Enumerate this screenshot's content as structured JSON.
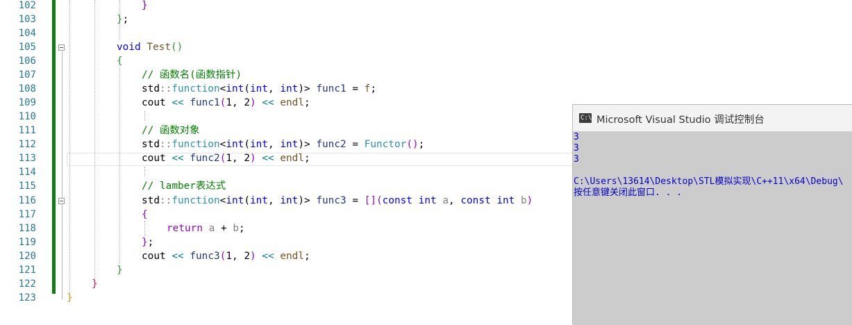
{
  "editor": {
    "lines": [
      {
        "num": "102"
      },
      {
        "num": "103"
      },
      {
        "num": "104"
      },
      {
        "num": "105"
      },
      {
        "num": "106"
      },
      {
        "num": "107"
      },
      {
        "num": "108"
      },
      {
        "num": "109"
      },
      {
        "num": "110"
      },
      {
        "num": "111"
      },
      {
        "num": "112"
      },
      {
        "num": "113"
      },
      {
        "num": "114"
      },
      {
        "num": "115"
      },
      {
        "num": "116"
      },
      {
        "num": "117"
      },
      {
        "num": "118"
      },
      {
        "num": "119"
      },
      {
        "num": "120"
      },
      {
        "num": "121"
      },
      {
        "num": "122"
      },
      {
        "num": "123"
      }
    ],
    "tokens": {
      "l102": {
        "brace": "}"
      },
      "l103": {
        "brace": "}",
        "semi": ";"
      },
      "l105": {
        "kw": "void",
        "fn": "Test",
        "parens": "()"
      },
      "l106": {
        "brace": "{"
      },
      "l107": {
        "comment": "// 函数名(函数指针)"
      },
      "l108": {
        "ns": "std",
        "sep": "::",
        "ty": "function",
        "lt": "<",
        "t1": "int",
        "lp": "(",
        "t2": "int",
        "comma": ", ",
        "t3": "int",
        "rp": ")",
        "gt": ">",
        "var": "func1",
        "eq": " = ",
        "rhs": "f",
        "semi": ";"
      },
      "l109": {
        "cout": "cout",
        "shl": "<<",
        "fn": "func1",
        "lp": "(",
        "args": "1, 2",
        "rp": ")",
        "shl2": "<<",
        "endl": "endl",
        "semi": ";"
      },
      "l111": {
        "comment": "// 函数对象"
      },
      "l112": {
        "ns": "std",
        "sep": "::",
        "ty": "function",
        "lt": "<",
        "t1": "int",
        "lp": "(",
        "t2": "int",
        "comma": ", ",
        "t3": "int",
        "rp": ")",
        "gt": ">",
        "var": "func2",
        "eq": " = ",
        "rhs": "Functor",
        "call": "()",
        "semi": ";"
      },
      "l113": {
        "cout": "cout",
        "shl": "<<",
        "fn": "func2",
        "lp": "(",
        "args": "1, 2",
        "rp": ")",
        "shl2": "<<",
        "endl": "endl",
        "semi": ";"
      },
      "l115": {
        "comment": "// lamber表达式"
      },
      "l116": {
        "ns": "std",
        "sep": "::",
        "ty": "function",
        "lt": "<",
        "t1": "int",
        "lp": "(",
        "t2": "int",
        "comma": ", ",
        "t3": "int",
        "rp": ")",
        "gt": ">",
        "var": "func3",
        "eq": " = ",
        "cap": "[]",
        "lp2": "(",
        "c1": "const",
        "i1": "int",
        "pa": "a",
        "comma2": ", ",
        "c2": "const",
        "i2": "int",
        "pb": "b",
        "rp2": ")"
      },
      "l117": {
        "brace": "{"
      },
      "l118": {
        "kw": "return",
        "a": "a",
        "plus": " + ",
        "b": "b",
        "semi": ";"
      },
      "l119": {
        "brace": "}",
        "semi": ";"
      },
      "l120": {
        "cout": "cout",
        "shl": "<<",
        "fn": "func3",
        "lp": "(",
        "args": "1, 2",
        "rp": ")",
        "shl2": "<<",
        "endl": "endl",
        "semi": ";"
      },
      "l121": {
        "brace": "}"
      },
      "l122": {
        "brace": "}"
      },
      "l123": {
        "brace": "}"
      }
    }
  },
  "console": {
    "title": "Microsoft Visual Studio 调试控制台",
    "icon_label": "C:\\",
    "lines": [
      "3",
      "3",
      "3",
      "",
      "C:\\Users\\13614\\Desktop\\STL模拟实现\\C++11\\x64\\Debug\\",
      "按任意键关闭此窗口. . ."
    ]
  },
  "colors": {
    "keyword": "#0000ff",
    "type": "#2b91af",
    "function": "#74531f",
    "variable": "#1f377f",
    "comment": "#008000",
    "line_number": "#237893",
    "console_text": "#0000c8",
    "change_bar": "#107c10"
  }
}
